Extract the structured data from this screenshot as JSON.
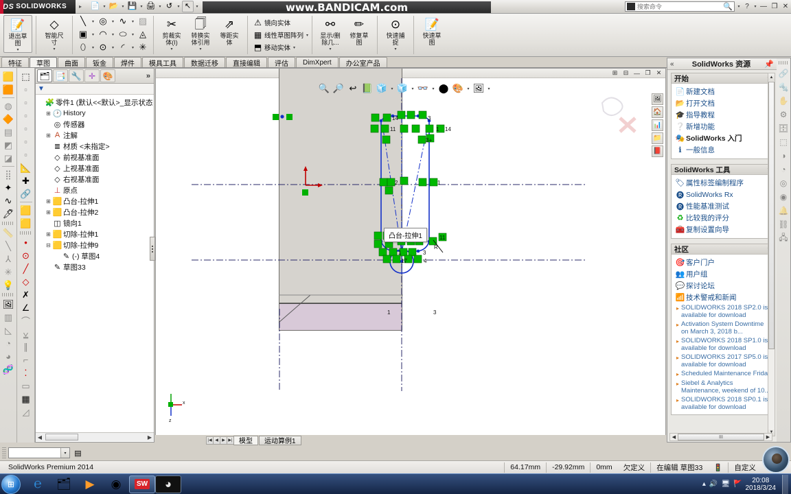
{
  "titlebar": {
    "brand": "SOLIDWORKS",
    "brand_prefix": "DS",
    "quick_buttons": [
      {
        "name": "new-document",
        "icon": "📄"
      },
      {
        "name": "open-document",
        "icon": "📂"
      },
      {
        "name": "save",
        "icon": "💾"
      },
      {
        "name": "print",
        "icon": "🖨"
      },
      {
        "name": "undo",
        "icon": "↺"
      },
      {
        "name": "select",
        "icon": "↖"
      },
      {
        "name": "rebuild",
        "icon": "🚦"
      },
      {
        "name": "file-properties",
        "icon": "🗂"
      },
      {
        "name": "options",
        "icon": "📋"
      }
    ],
    "search_placeholder": "搜索命令",
    "help_label": "?",
    "minimize": "—",
    "restore": "❐",
    "close": "✕"
  },
  "watermark": "www.BANDICAM.com",
  "ribbon": {
    "exit_sketch": {
      "label_line1": "退出草",
      "label_line2": "图"
    },
    "smart_dimension": {
      "label_line1": "智能尺",
      "label_line2": "寸"
    },
    "sketch_tools": [
      {
        "name": "line",
        "icon": "╲"
      },
      {
        "name": "circle",
        "icon": "◎"
      },
      {
        "name": "spline",
        "icon": "∿"
      },
      {
        "name": "hatch",
        "icon": "▨"
      },
      {
        "name": "rectangle",
        "icon": "▣"
      },
      {
        "name": "arc",
        "icon": "◠"
      },
      {
        "name": "ellipse",
        "icon": "⬭"
      },
      {
        "name": "polygon",
        "icon": "◬"
      },
      {
        "name": "slot",
        "icon": "⬯"
      },
      {
        "name": "point",
        "icon": "⊙"
      },
      {
        "name": "fillet",
        "icon": "◜"
      },
      {
        "name": "spline-on-surface",
        "icon": "✳"
      }
    ],
    "trim": {
      "label_line1": "剪裁实",
      "label_line2": "体(I)"
    },
    "convert": {
      "label_line1": "转换实",
      "label_line2": "体引用"
    },
    "offset": {
      "label_line1": "等距实",
      "label_line2": "体"
    },
    "list_items": [
      {
        "label": "镜向实体",
        "icon": "⚠",
        "caret": false
      },
      {
        "label": "线性草图阵列",
        "icon": "▦",
        "caret": true
      },
      {
        "label": "移动实体",
        "icon": "⬒",
        "caret": true
      }
    ],
    "display_delete": {
      "label_line1": "显示/删",
      "label_line2": "除几..."
    },
    "repair_sketch": {
      "label_line1": "修复草",
      "label_line2": "图"
    },
    "quick_snap": {
      "label_line1": "快速捕",
      "label_line2": "捉"
    },
    "quick_sketch": {
      "label_line1": "快速草",
      "label_line2": "图"
    }
  },
  "tabs": [
    {
      "label": "特征",
      "active": false
    },
    {
      "label": "草图",
      "active": true
    },
    {
      "label": "曲面",
      "active": false
    },
    {
      "label": "钣金",
      "active": false
    },
    {
      "label": "焊件",
      "active": false
    },
    {
      "label": "模具工具",
      "active": false
    },
    {
      "label": "数据迁移",
      "active": false
    },
    {
      "label": "直接编辑",
      "active": false
    },
    {
      "label": "评估",
      "active": false
    },
    {
      "label": "DimXpert",
      "active": false
    },
    {
      "label": "办公室产品",
      "active": false
    }
  ],
  "tree_panel": {
    "tabs": [
      {
        "name": "feature-manager",
        "icon": "🗂",
        "active": true
      },
      {
        "name": "property-manager",
        "icon": "📑",
        "active": false
      },
      {
        "name": "configuration-manager",
        "icon": "🔧",
        "active": false
      },
      {
        "name": "dimxpert-manager",
        "icon": "✛",
        "active": false
      },
      {
        "name": "display-manager",
        "icon": "🎨",
        "active": false
      }
    ],
    "more_label": "»",
    "filter_icon": "▽",
    "nodes": [
      {
        "label": "零件1  (默认<<默认>_显示状态",
        "icon": "🧩",
        "expand": "",
        "indent": 1
      },
      {
        "label": "History",
        "icon": "🕑",
        "expand": "+",
        "indent": 2
      },
      {
        "label": "传感器",
        "icon": "◎",
        "expand": "",
        "indent": 2
      },
      {
        "label": "注解",
        "icon": "A",
        "expand": "+",
        "indent": 2
      },
      {
        "label": "材质 <未指定>",
        "icon": "≣",
        "expand": "",
        "indent": 2
      },
      {
        "label": "前视基准面",
        "icon": "◇",
        "expand": "",
        "indent": 2
      },
      {
        "label": "上视基准面",
        "icon": "◇",
        "expand": "",
        "indent": 2
      },
      {
        "label": "右视基准面",
        "icon": "◇",
        "expand": "",
        "indent": 2
      },
      {
        "label": "原点",
        "icon": "⊥",
        "expand": "",
        "indent": 2
      },
      {
        "label": "凸台-拉伸1",
        "icon": "▤",
        "expand": "+",
        "indent": 2
      },
      {
        "label": "凸台-拉伸2",
        "icon": "▤",
        "expand": "+",
        "indent": 2
      },
      {
        "label": "镜向1",
        "icon": "◫",
        "expand": "",
        "indent": 2
      },
      {
        "label": "切除-拉伸1",
        "icon": "▣",
        "expand": "+",
        "indent": 2
      },
      {
        "label": "切除-拉伸9",
        "icon": "▣",
        "expand": "−",
        "indent": 2
      },
      {
        "label": "(-) 草图4",
        "icon": "✎",
        "expand": "",
        "indent": 3
      },
      {
        "label": "草图33",
        "icon": "✎",
        "expand": "",
        "indent": 2
      }
    ]
  },
  "graphics": {
    "window_buttons": [
      "⊞",
      "⊟",
      "—",
      "❐",
      "✕"
    ],
    "view_toolbar": [
      {
        "name": "zoom-to-fit",
        "icon": "🔍"
      },
      {
        "name": "zoom-to-area",
        "icon": "🔎"
      },
      {
        "name": "previous-view",
        "icon": "↩"
      },
      {
        "name": "section-view",
        "icon": "📗"
      },
      {
        "name": "view-orientation",
        "icon": "🧊"
      },
      {
        "name": "display-style",
        "icon": "⬜"
      },
      {
        "name": "hide-show-items",
        "icon": "👓"
      },
      {
        "name": "edit-appearance",
        "icon": "⬤"
      },
      {
        "name": "apply-scene",
        "icon": "🎨"
      },
      {
        "name": "view-settings",
        "icon": "🖼"
      }
    ],
    "tooltip": "凸台-拉伸1",
    "right_icons": [
      {
        "name": "view-palette",
        "icon": "🖼"
      },
      {
        "name": "home-view",
        "icon": "🏠"
      },
      {
        "name": "appearances",
        "icon": "📊"
      },
      {
        "name": "custom-properties",
        "icon": "📁"
      },
      {
        "name": "design-library",
        "icon": "📕"
      }
    ],
    "model_tabs": [
      {
        "label": "模型",
        "active": true
      },
      {
        "label": "运动算例1",
        "active": false
      }
    ]
  },
  "task_pane": {
    "title": "SolidWorks 资源",
    "collapse_icon": "«",
    "pin_icon": "📌",
    "sections": [
      {
        "title": "开始",
        "items": [
          {
            "label": "新建文档",
            "icon": "📄",
            "bold": false
          },
          {
            "label": "打开文档",
            "icon": "📂",
            "bold": false
          },
          {
            "label": "指导教程",
            "icon": "🎓",
            "bold": false
          },
          {
            "label": "新增功能",
            "icon": "❓",
            "bold": false
          },
          {
            "label": "SolidWorks 入门",
            "icon": "🎭",
            "bold": true
          },
          {
            "label": "一般信息",
            "icon": "ℹ",
            "bold": false
          }
        ]
      },
      {
        "title": "SolidWorks 工具",
        "items": [
          {
            "label": "属性标签编制程序",
            "icon": "🏷",
            "bold": false
          },
          {
            "label": "SolidWorks Rx",
            "icon": "Ⓡ",
            "bold": false
          },
          {
            "label": "性能基准测试",
            "icon": "Ⓡ",
            "bold": false
          },
          {
            "label": "比较我的评分",
            "icon": "♻",
            "bold": false
          },
          {
            "label": "复制设置向导",
            "icon": "🧰",
            "bold": false
          }
        ]
      },
      {
        "title": "社区",
        "items": [
          {
            "label": "客户门户",
            "icon": "🎯",
            "bold": false
          },
          {
            "label": "用户组",
            "icon": "👥",
            "bold": false
          },
          {
            "label": "探讨论坛",
            "icon": "💬",
            "bold": false
          },
          {
            "label": "技术警戒和新闻",
            "icon": "📶",
            "bold": false
          }
        ]
      }
    ],
    "news": [
      "SOLIDWORKS 2018 SP2.0 is available for download",
      "Activation System Downtime on March 3, 2018 b...",
      "SOLIDWORKS 2018 SP1.0 is available for download",
      "SOLIDWORKS 2017 SP5.0 is available for download",
      "Scheduled Maintenance Friday",
      "Siebel & Analytics Maintenance, weekend of 10...",
      "SOLIDWORKS 2018 SP0.1 is available for download"
    ],
    "hscroll_grip": "III"
  },
  "statusbar": {
    "product": "SolidWorks Premium 2014",
    "coord_x": "64.17mm",
    "coord_y": "-29.92mm",
    "coord_z": "0mm",
    "state": "欠定义",
    "editing": "在编辑 草图33",
    "custom": "自定义",
    "caret": "▴",
    "help_icon": "?"
  },
  "combobar": {
    "combo_value": "",
    "combo_arrow": "▾",
    "side_icon": "▤"
  },
  "taskbar": {
    "start_icon": "⊞",
    "apps": [
      {
        "name": "internet-explorer",
        "icon": "℮",
        "active": false
      },
      {
        "name": "file-explorer",
        "icon": "🗂",
        "active": false
      },
      {
        "name": "media-player",
        "icon": "▶",
        "active": false
      },
      {
        "name": "google-chrome",
        "icon": "◉",
        "active": false
      },
      {
        "name": "solidworks",
        "icon": "SW",
        "active": true
      },
      {
        "name": "bandicam",
        "icon": "◕",
        "active": true
      }
    ],
    "tray_icons": [
      "▴",
      "🔊",
      "🖥",
      "🚩"
    ],
    "time": "20:08",
    "date": "2018/3/24"
  }
}
